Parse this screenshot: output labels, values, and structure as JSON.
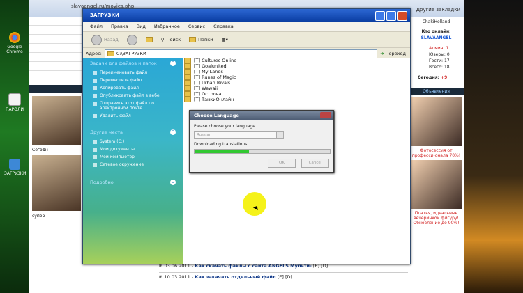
{
  "browser": {
    "url": "slavaangel.ru/movies.php",
    "bookmarks_label": "Другие закладки"
  },
  "desktop": {
    "icons": [
      {
        "label": "Google Chrome"
      },
      {
        "label": "ПАРОЛИ"
      },
      {
        "label": "ЗАГРУЗКИ"
      }
    ]
  },
  "site": {
    "right_panel": {
      "username": "ChakiHolland",
      "online_title": "Кто онлайн:",
      "online_user": "SLAVAANGEL",
      "stats": [
        {
          "label": "Админ:",
          "value": "1"
        },
        {
          "label": "Юзеры:",
          "value": "0"
        },
        {
          "label": "Гости:",
          "value": "17"
        },
        {
          "label": "Всего:",
          "value": "18"
        }
      ],
      "today_label": "Сегодня:",
      "today_value": "+9",
      "ads_header": "Объявления",
      "ad1_caption": "Фотосессия от професси-онала 70%!",
      "ad2_caption": "Платья, идеальные вечеринкой фигуру! Обновление до 90%!"
    },
    "news": [
      {
        "date": "03.06.2011",
        "title": "Как скачать файлы с сайта ANGELS Мульти-",
        "tags": "[E] [D]"
      },
      {
        "date": "10.03.2011",
        "title": "Как закачать отдельный файл",
        "tags": "[E] [D]"
      }
    ],
    "left_captions": [
      "Сегодн",
      "супер"
    ]
  },
  "explorer": {
    "title": "ЗАГРУЗКИ",
    "menu": [
      "Файл",
      "Правка",
      "Вид",
      "Избранное",
      "Сервис",
      "Справка"
    ],
    "toolbar": {
      "back": "Назад",
      "search": "Поиск",
      "folders": "Папки"
    },
    "address_label": "Адрес:",
    "address_value": "C:\\ЗАГРУЗКИ",
    "go_label": "Переход",
    "tasks_header": "Задачи для файлов и папок",
    "tasks": [
      "Переименовать файл",
      "Переместить файл",
      "Копировать файл",
      "Опубликовать файл в вебе",
      "Отправить этот файл по электронной почте",
      "Удалить файл"
    ],
    "places_header": "Другие места",
    "places": [
      "System (C:)",
      "Мои документы",
      "Мой компьютер",
      "Сетевое окружение"
    ],
    "details_header": "Подробно",
    "files": [
      "[T] Cultures Online",
      "[T] Goalunited",
      "[T] My Lands",
      "[T] Runes of Magic",
      "[T] Urban Rivals",
      "[T] Wewaii",
      "[T] Острова",
      "[T] ТанкиОнлайн"
    ]
  },
  "dialog": {
    "title": "Choose Language",
    "prompt": "Please choose your language",
    "selected_language": "Russian",
    "status": "Downloading translations...",
    "progress": 0.4,
    "ok_label": "OK",
    "cancel_label": "Cancel"
  }
}
